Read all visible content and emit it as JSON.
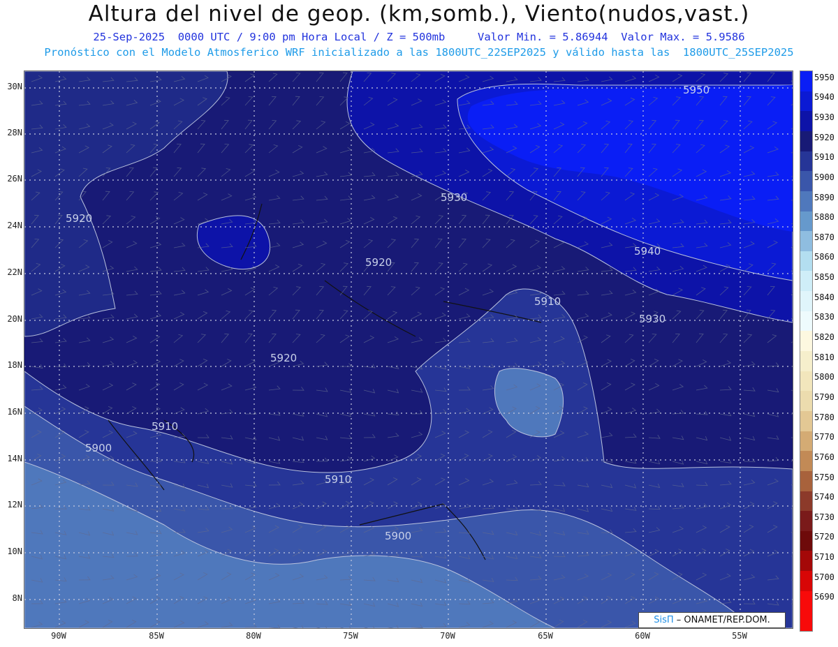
{
  "title": "Altura del nivel de geop. (km,somb.), Viento(nudos,vast.)",
  "subtitle": "25-Sep-2025  0000 UTC / 9:00 pm Hora Local / Z = 500mb     Valor Min. = 5.86944  Valor Max. = 5.9586",
  "subtitle2": "Pronóstico con el Modelo Atmosferico WRF inicializado a las 1800UTC_22SEP2025 y válido hasta las  1800UTC_25SEP2025",
  "lat_ticks": [
    "30N",
    "28N",
    "26N",
    "24N",
    "22N",
    "20N",
    "18N",
    "16N",
    "14N",
    "12N",
    "10N",
    "8N"
  ],
  "lon_ticks": [
    "90W",
    "85W",
    "80W",
    "75W",
    "70W",
    "65W",
    "60W",
    "55W"
  ],
  "contour_labels": [
    "5950",
    "5930",
    "5920",
    "5940",
    "5920",
    "5910",
    "5930",
    "5920",
    "5910",
    "5900",
    "5910",
    "5900"
  ],
  "colorbar": {
    "labels": [
      "5950",
      "5940",
      "5930",
      "5920",
      "5910",
      "5900",
      "5890",
      "5880",
      "5870",
      "5860",
      "5850",
      "5840",
      "5830",
      "5820",
      "5810",
      "5800",
      "5790",
      "5780",
      "5770",
      "5760",
      "5750",
      "5740",
      "5730",
      "5720",
      "5710",
      "5700",
      "5690"
    ],
    "colors": [
      "#0a1ef5",
      "#0b1ad4",
      "#0d13a8",
      "#181a76",
      "#263597",
      "#3a56aa",
      "#4f78bc",
      "#6699cc",
      "#8fbde0",
      "#b3def0",
      "#cfeef8",
      "#e0f5fb",
      "#eefbfd",
      "#fdf8e0",
      "#f6efcc",
      "#f2e6bc",
      "#ecdcae",
      "#e3c894",
      "#d4ab74",
      "#c28a56",
      "#a8623c",
      "#8c3a2a",
      "#7a1a1a",
      "#6e0a0a",
      "#a40808",
      "#d80606",
      "#f80a0a"
    ]
  },
  "credit": {
    "brand": "SisΠ",
    "text": " – ONAMET/REP.DOM."
  }
}
